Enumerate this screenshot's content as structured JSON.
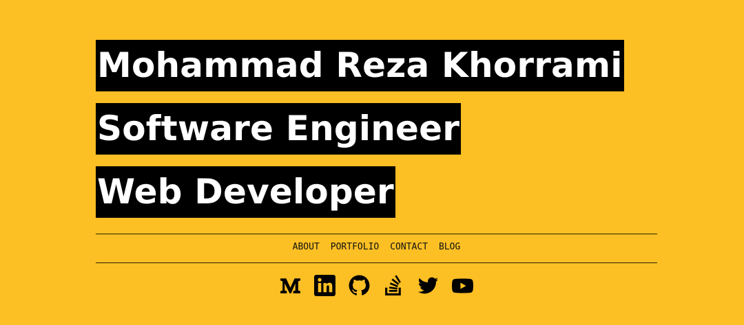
{
  "hero": {
    "name": "Mohammad Reza Khorrami",
    "role_1": "Software Engineer",
    "role_2": "Web Developer"
  },
  "nav": {
    "items": [
      "ABOUT",
      "PORTFOLIO",
      "CONTACT",
      "BLOG"
    ]
  },
  "social": {
    "icons": [
      "medium-icon",
      "linkedin-icon",
      "github-icon",
      "stackoverflow-icon",
      "twitter-icon",
      "youtube-icon"
    ]
  },
  "colors": {
    "background": "#FCBF24",
    "highlight": "#000000",
    "text_on_highlight": "#FFFFFF",
    "text": "#111111"
  }
}
